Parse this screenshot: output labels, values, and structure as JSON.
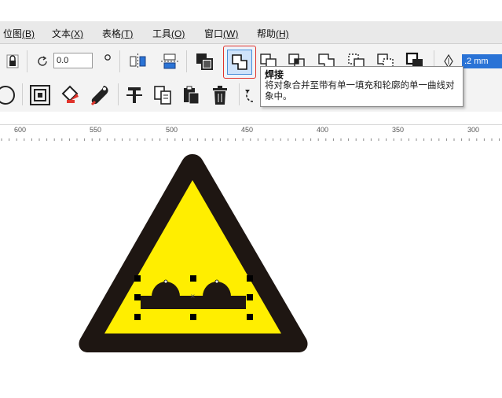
{
  "menu": {
    "items": [
      {
        "label": "位图",
        "key": "(B)"
      },
      {
        "label": "文本",
        "key": "(X)"
      },
      {
        "label": "表格",
        "key": "(T)"
      },
      {
        "label": "工具",
        "key": "(O)"
      },
      {
        "label": "窗口",
        "key": "(W)"
      },
      {
        "label": "帮助",
        "key": "(H)"
      }
    ]
  },
  "property_bar": {
    "rotation_value": "0.0",
    "outline_width": ".2 mm"
  },
  "tooltip": {
    "title": "焊接",
    "description": "将对象合并至带有单一填充和轮廓的单一曲线对象中。"
  },
  "ruler": {
    "labels": [
      "600",
      "550",
      "500",
      "450",
      "400",
      "350",
      "300"
    ]
  },
  "colors": {
    "sign_fill": "#ffee00",
    "sign_border": "#1e1612",
    "highlight": "#e0342c",
    "selection_input": "#2a73d6"
  },
  "icons": [
    "lock-icon",
    "rotate-icon",
    "degree-icon",
    "mirror-horizontal-icon",
    "mirror-vertical-icon",
    "group-objects-icon",
    "weld-icon",
    "trim-icon",
    "intersect-icon",
    "simplify-icon",
    "front-minus-back-icon",
    "back-minus-front-icon",
    "boundary-icon",
    "outline-pen-icon",
    "ellipse-icon",
    "contour-icon",
    "fill-icon",
    "color-eyedropper-icon",
    "text-tool-icon",
    "copy-properties-icon",
    "paste-icon",
    "delete-icon",
    "undo-icon"
  ]
}
